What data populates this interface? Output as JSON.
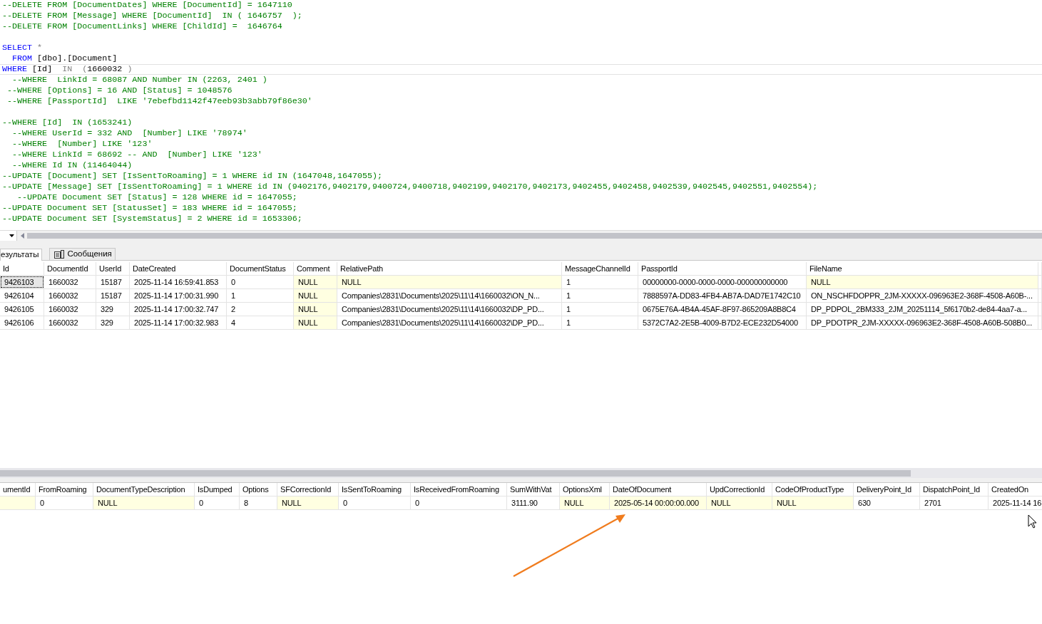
{
  "editor": {
    "lines": [
      {
        "current": false,
        "tokens": [
          {
            "kind": "comment",
            "text": "--DELETE FROM [DocumentDates] WHERE [DocumentId] = 1647110"
          }
        ]
      },
      {
        "current": false,
        "tokens": [
          {
            "kind": "comment",
            "text": "--DELETE FROM [Message] WHERE [DocumentId]  IN ( 1646757  );"
          }
        ]
      },
      {
        "current": false,
        "tokens": [
          {
            "kind": "comment",
            "text": "--DELETE FROM [DocumentLinks] WHERE [ChildId] =  1646764"
          }
        ]
      },
      {
        "current": false
      },
      {
        "current": false,
        "tokens": [
          {
            "kind": "keyword",
            "text": "SELECT"
          },
          {
            "kind": "operator",
            "text": " *"
          }
        ]
      },
      {
        "current": false,
        "tokens": [
          {
            "kind": "keyword",
            "text": "  FROM"
          },
          {
            "kind": "plain",
            "text": " [dbo].[Document]"
          }
        ]
      },
      {
        "current": true,
        "tokens": [
          {
            "kind": "keyword",
            "text": "WHERE"
          },
          {
            "kind": "plain",
            "text": " [Id]  "
          },
          {
            "kind": "operator",
            "text": "IN  ("
          },
          {
            "kind": "plain",
            "text": "1660032 "
          },
          {
            "kind": "operator",
            "text": ")"
          }
        ]
      },
      {
        "current": false,
        "tokens": [
          {
            "kind": "comment",
            "text": "  --WHERE  LinkId = 68087 AND Number IN (2263, 2401 )"
          }
        ]
      },
      {
        "current": false,
        "tokens": [
          {
            "kind": "comment",
            "text": " --WHERE [Options] = 16 AND [Status] = 1048576"
          }
        ]
      },
      {
        "current": false,
        "tokens": [
          {
            "kind": "comment",
            "text": " --WHERE [PassportId]  LIKE '7ebefbd1142f47eeb93b3abb79f86e30'"
          }
        ]
      },
      {
        "current": false
      },
      {
        "current": false,
        "tokens": [
          {
            "kind": "comment",
            "text": "--WHERE [Id]  IN (1653241)"
          }
        ]
      },
      {
        "current": false,
        "tokens": [
          {
            "kind": "comment",
            "text": "  --WHERE UserId = 332 AND  [Number] LIKE '78974'"
          }
        ]
      },
      {
        "current": false,
        "tokens": [
          {
            "kind": "comment",
            "text": "  --WHERE  [Number] LIKE '123'"
          }
        ]
      },
      {
        "current": false,
        "tokens": [
          {
            "kind": "comment",
            "text": "  --WHERE LinkId = 68692 -- AND  [Number] LIKE '123'"
          }
        ]
      },
      {
        "current": false,
        "tokens": [
          {
            "kind": "comment",
            "text": "  --WHERE Id IN (11464044)"
          }
        ]
      },
      {
        "current": false,
        "tokens": [
          {
            "kind": "comment",
            "text": "--UPDATE [Document] SET [IsSentToRoaming] = 1 WHERE id IN (1647048,1647055);"
          }
        ]
      },
      {
        "current": false,
        "tokens": [
          {
            "kind": "comment",
            "text": "--UPDATE [Message] SET [IsSentToRoaming] = 1 WHERE id IN (9402176,9402179,9400724,9400718,9402199,9402170,9402173,9402455,9402458,9402539,9402545,9402551,9402554);"
          }
        ]
      },
      {
        "current": false,
        "tokens": [
          {
            "kind": "comment",
            "text": "   --UPDATE Document SET [Status] = 128 WHERE id = 1647055;"
          }
        ]
      },
      {
        "current": false,
        "tokens": [
          {
            "kind": "comment",
            "text": "--UPDATE Document SET [StatusSet] = 183 WHERE id = 1647055;"
          }
        ]
      },
      {
        "current": false,
        "tokens": [
          {
            "kind": "comment",
            "text": "--UPDATE Document SET [SystemStatus] = 2 WHERE id = 1653306;"
          }
        ]
      }
    ]
  },
  "result_tabs": [
    {
      "label": "езультаты",
      "selected": true,
      "icon": false
    },
    {
      "label": "Сообщения",
      "selected": false,
      "icon": true
    }
  ],
  "grid_1": {
    "columns": [
      "Id",
      "DocumentId",
      "UserId",
      "DateCreated",
      "DocumentStatus",
      "Comment",
      "RelativePath",
      "MessageChannelId",
      "PassportId",
      "FileName"
    ],
    "rows": [
      {
        "current": true,
        "cells": [
          {
            "text": "9426103",
            "shaded": false
          },
          {
            "text": "1660032",
            "shaded": false
          },
          {
            "text": "15187",
            "shaded": false
          },
          {
            "text": "2025-11-14 16:59:41.853",
            "shaded": false
          },
          {
            "text": "0",
            "shaded": false
          },
          {
            "text": "NULL",
            "shaded": true
          },
          {
            "text": "NULL",
            "shaded": true
          },
          {
            "text": "1",
            "shaded": false
          },
          {
            "text": "00000000-0000-0000-0000-000000000000",
            "shaded": false
          },
          {
            "text": "NULL",
            "shaded": true
          }
        ]
      },
      {
        "current": false,
        "cells": [
          {
            "text": "9426104",
            "shaded": false
          },
          {
            "text": "1660032",
            "shaded": false
          },
          {
            "text": "15187",
            "shaded": false
          },
          {
            "text": "2025-11-14 17:00:31.990",
            "shaded": false
          },
          {
            "text": "1",
            "shaded": false
          },
          {
            "text": "NULL",
            "shaded": true
          },
          {
            "text": "Companies\\2831\\Documents\\2025\\11\\14\\1660032\\ON_N...",
            "shaded": false
          },
          {
            "text": "1",
            "shaded": false
          },
          {
            "text": "7888597A-DD83-4FB4-AB7A-DAD7E1742C10",
            "shaded": false
          },
          {
            "text": "ON_NSCHFDOPPR_2JM-XXXXX-096963E2-368F-4508-A60B-...",
            "shaded": false
          }
        ]
      },
      {
        "current": false,
        "cells": [
          {
            "text": "9426105",
            "shaded": false
          },
          {
            "text": "1660032",
            "shaded": false
          },
          {
            "text": "329",
            "shaded": false
          },
          {
            "text": "2025-11-14 17:00:32.747",
            "shaded": false
          },
          {
            "text": "2",
            "shaded": false
          },
          {
            "text": "NULL",
            "shaded": true
          },
          {
            "text": "Companies\\2831\\Documents\\2025\\11\\14\\1660032\\DP_PD...",
            "shaded": false
          },
          {
            "text": "1",
            "shaded": false
          },
          {
            "text": "0675E76A-4B4A-45AF-8F97-865209A8B8C4",
            "shaded": false
          },
          {
            "text": "DP_PDPOL_2BM333_2JM_20251114_5f6170b2-de84-4aa7-a...",
            "shaded": false
          }
        ]
      },
      {
        "current": false,
        "cells": [
          {
            "text": "9426106",
            "shaded": false
          },
          {
            "text": "1660032",
            "shaded": false
          },
          {
            "text": "329",
            "shaded": false
          },
          {
            "text": "2025-11-14 17:00:32.983",
            "shaded": false
          },
          {
            "text": "4",
            "shaded": false
          },
          {
            "text": "NULL",
            "shaded": true
          },
          {
            "text": "Companies\\2831\\Documents\\2025\\11\\14\\1660032\\DP_PD...",
            "shaded": false
          },
          {
            "text": "1",
            "shaded": false
          },
          {
            "text": "5372C7A2-2E5B-4009-B7D2-ECE232D54000",
            "shaded": false
          },
          {
            "text": "DP_PDOTPR_2JM-XXXXX-096963E2-368F-4508-A60B-508B0...",
            "shaded": false
          }
        ]
      }
    ]
  },
  "grid_2": {
    "columns": [
      "umentId",
      "FromRoaming",
      "DocumentTypeDescription",
      "IsDumped",
      "Options",
      "SFCorrectionId",
      "IsSentToRoaming",
      "IsReceivedFromRoaming",
      "SumWithVat",
      "OptionsXml",
      "DateOfDocument",
      "UpdCorrectionId",
      "CodeOfProductType",
      "DeliveryPoint_Id",
      "DispatchPoint_Id",
      "CreatedOn"
    ],
    "rows": [
      {
        "current": false,
        "cells": [
          {
            "shaded": true
          },
          {
            "text": "0",
            "shaded": false
          },
          {
            "text": "NULL",
            "shaded": true
          },
          {
            "text": "0",
            "shaded": false
          },
          {
            "text": "8",
            "shaded": false
          },
          {
            "text": "NULL",
            "shaded": true
          },
          {
            "text": "0",
            "shaded": false
          },
          {
            "text": "0",
            "shaded": false
          },
          {
            "text": "3111.90",
            "shaded": false
          },
          {
            "text": "NULL",
            "shaded": true
          },
          {
            "text": "2025-05-14 00:00:00.000",
            "shaded": true
          },
          {
            "text": "NULL",
            "shaded": true
          },
          {
            "text": "NULL",
            "shaded": true
          },
          {
            "text": "630",
            "shaded": false
          },
          {
            "text": "2701",
            "shaded": false
          },
          {
            "text": "2025-11-14 16",
            "shaded": false
          }
        ]
      }
    ]
  }
}
